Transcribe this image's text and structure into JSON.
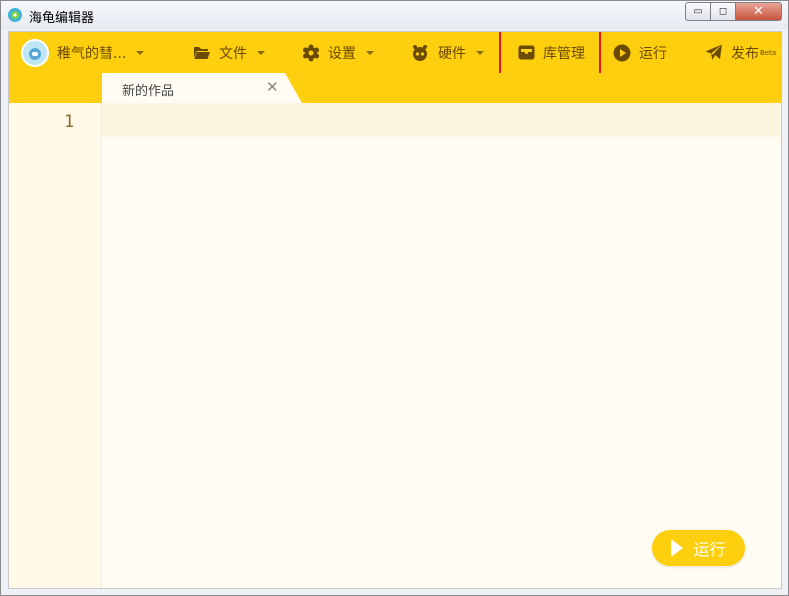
{
  "window": {
    "title": "海龟编辑器",
    "minimize_glyph": "▭",
    "maximize_glyph": "◻",
    "close_glyph": "✕"
  },
  "menubar": {
    "user_label": "稚气的彗...",
    "file_label": "文件",
    "settings_label": "设置",
    "hardware_label": "硬件",
    "library_label": "库管理",
    "run_label": "运行",
    "publish_label": "发布",
    "publish_badge": "Beta"
  },
  "tabs": [
    {
      "label": "新的作品",
      "close_glyph": "✕"
    }
  ],
  "editor": {
    "line_numbers": [
      "1"
    ]
  },
  "run_button": {
    "label": "运行"
  },
  "colors": {
    "accent": "#fecf0e",
    "highlight": "#e8141c",
    "editor_bg": "#fffdf3"
  }
}
